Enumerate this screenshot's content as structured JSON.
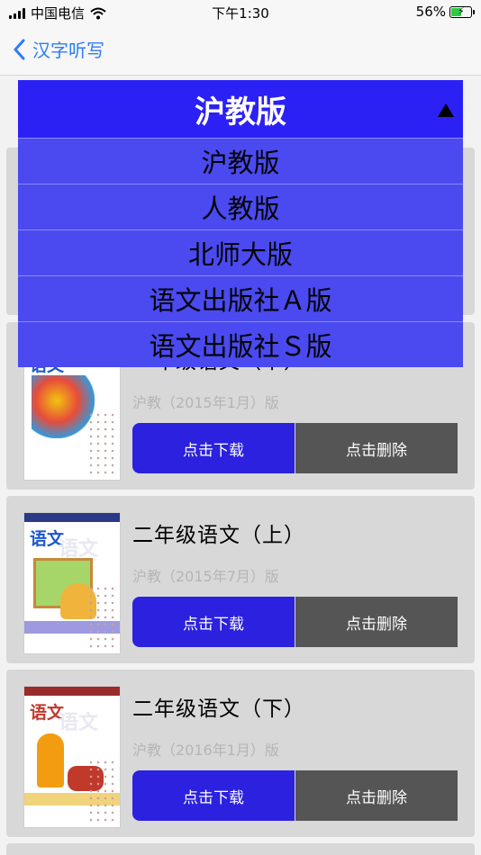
{
  "status": {
    "carrier": "中国电信",
    "time": "下午1:30",
    "battery": "56%",
    "battery_level": 0.56
  },
  "nav": {
    "back_label": "汉字听写"
  },
  "dropdown": {
    "selected": "沪教版",
    "options": [
      "沪教版",
      "人教版",
      "北师大版",
      "语文出版社Ａ版",
      "语文出版社Ｓ版"
    ]
  },
  "books": [
    {
      "title": "",
      "edition": "",
      "download": "",
      "delete": ""
    },
    {
      "title": "一年级语文（下）",
      "edition": "沪教（2015年1月）版",
      "download": "点击下载",
      "delete": "点击删除"
    },
    {
      "title": "二年级语文（上）",
      "edition": "沪教（2015年7月）版",
      "download": "点击下载",
      "delete": "点击删除"
    },
    {
      "title": "二年级语文（下）",
      "edition": "沪教（2016年1月）版",
      "download": "点击下载",
      "delete": "点击删除"
    }
  ],
  "cover": {
    "label": "语文"
  },
  "colors": {
    "accent": "#2b21de",
    "dropdown_head": "#2b21f5",
    "dropdown_item": "#4a4af0",
    "delete": "#555555",
    "nav_tint": "#2f7cf6"
  }
}
